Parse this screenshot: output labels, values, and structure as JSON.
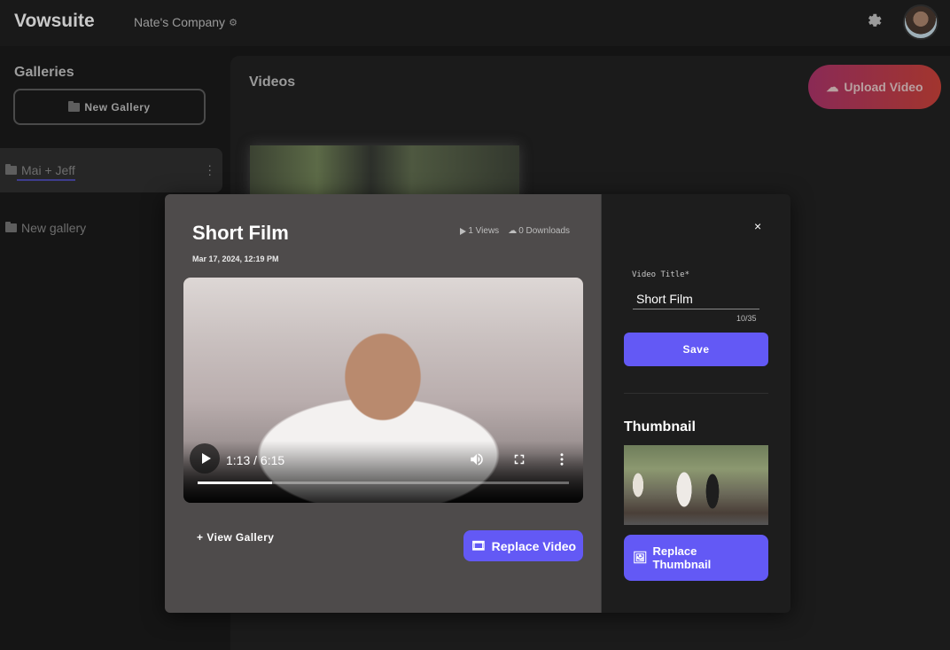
{
  "header": {
    "brand": "Vowsuite",
    "company": "Nate's Company",
    "icons": {
      "company_settings": "gear-icon",
      "settings": "gear-icon",
      "avatar": "user-avatar"
    }
  },
  "sidebar": {
    "title": "Galleries",
    "new_gallery_label": "New Gallery",
    "items": [
      {
        "label": "Mai + Jeff",
        "active": true
      },
      {
        "label": "New gallery",
        "active": false
      }
    ]
  },
  "main": {
    "title": "Videos",
    "upload_label": "Upload Video",
    "accent_gradient": [
      "#8a2a55",
      "#a2352e"
    ]
  },
  "modal": {
    "title": "Short Film",
    "date": "Mar 17, 2024, 12:19 PM",
    "views": "1 Views",
    "downloads": "0 Downloads",
    "player": {
      "time": "1:13 / 6:15",
      "progress": 0.2
    },
    "view_gallery_label": "View Gallery",
    "replace_video_label": "Replace Video",
    "close_label": "×",
    "form": {
      "field_label": "Video Title*",
      "field_value": "Short Film",
      "counter": "10/35",
      "save_label": "Save"
    },
    "thumbnail_heading": "Thumbnail",
    "replace_thumbnail_label": "Replace Thumbnail",
    "accent_color": "#6359f5"
  }
}
